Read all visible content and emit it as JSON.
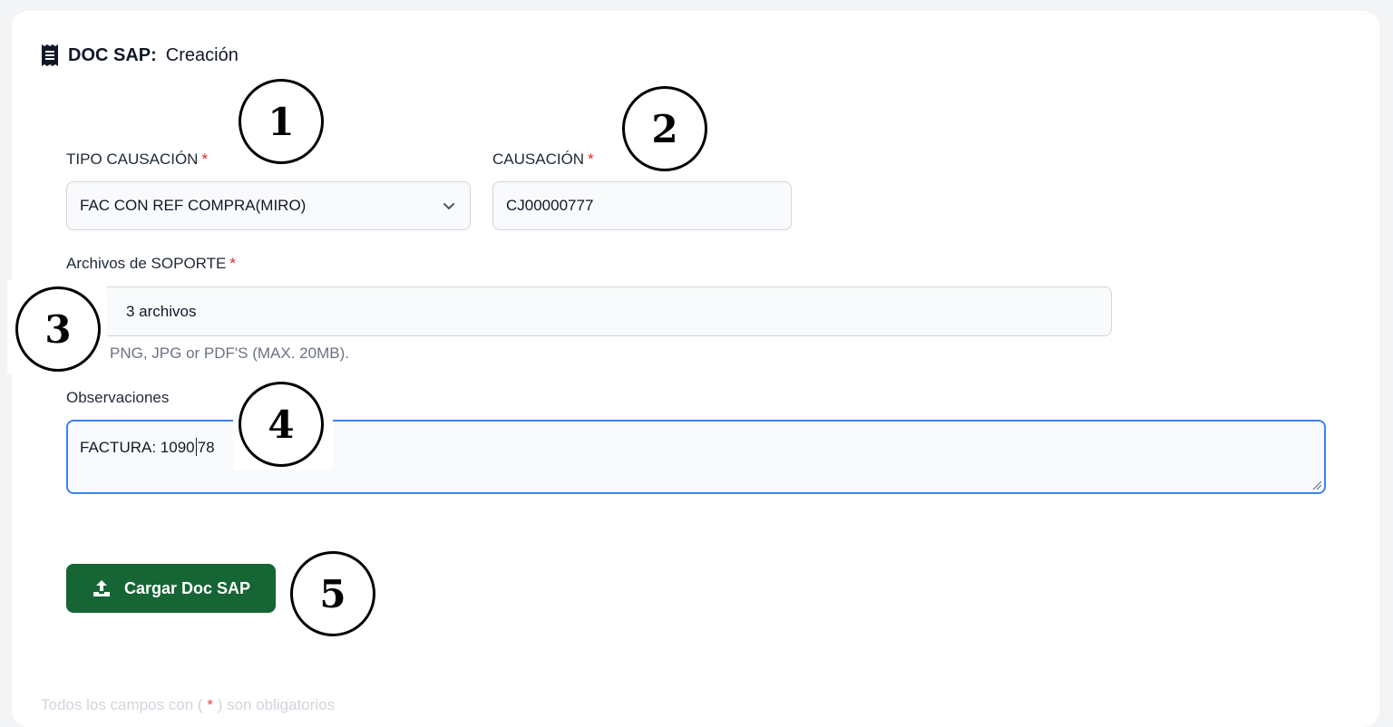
{
  "header": {
    "title_strong": "DOC SAP:",
    "title_rest": "Creación",
    "icon": "receipt-icon"
  },
  "form": {
    "tipo_causacion": {
      "label": "TIPO CAUSACIÓN",
      "required_mark": "*",
      "value": "FAC CON REF COMPRA(MIRO)"
    },
    "causacion": {
      "label": "CAUSACIÓN",
      "required_mark": "*",
      "value": "CJ00000777"
    },
    "archivos": {
      "label": "Archivos de SOPORTE",
      "required_mark": "*",
      "value": "3 archivos",
      "hint": "PNG, JPG or PDF'S (MAX. 20MB)."
    },
    "observaciones": {
      "label": "Observaciones",
      "value_before_caret": "FACTURA: 1090",
      "value_after_caret": "78"
    },
    "submit": {
      "label": "Cargar Doc SAP",
      "icon": "upload-icon"
    },
    "footnote": {
      "before": "Todos los campos con (",
      "star": "*",
      "after": ") son obligatorios"
    }
  },
  "annotations": [
    "1",
    "2",
    "3",
    "4",
    "5"
  ],
  "colors": {
    "accent_focus": "#3b82f6",
    "button_bg": "#166534",
    "required": "#dc2626"
  }
}
